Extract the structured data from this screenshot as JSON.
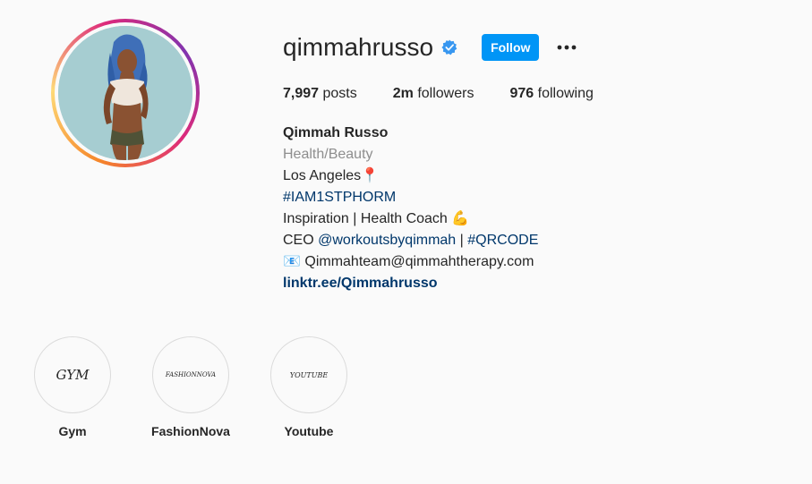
{
  "profile": {
    "username": "qimmahrusso",
    "verified": true,
    "follow_label": "Follow",
    "more_icon": "more-horizontal-icon",
    "accent_color": "#0095f6"
  },
  "stats": {
    "posts_count": "7,997",
    "posts_label": "posts",
    "followers_count": "2m",
    "followers_label": "followers",
    "following_count": "976",
    "following_label": "following"
  },
  "bio": {
    "full_name": "Qimmah Russo",
    "category": "Health/Beauty",
    "location": "Los Angeles",
    "location_emoji": "📍",
    "hashtag": "#IAM1STPHORM",
    "tagline": "Inspiration | Health Coach ",
    "tagline_emoji": "💪",
    "ceo_prefix": "CEO ",
    "ceo_mention": "@workoutsbyqimmah",
    "ceo_separator": " | ",
    "ceo_hashtag": "#QRCODE",
    "email_emoji": "📧",
    "email": "Qimmahteam@qimmahtherapy.com",
    "link": "linktr.ee/Qimmahrusso"
  },
  "highlights": [
    {
      "cover_text": "GYM",
      "label": "Gym"
    },
    {
      "cover_text": "FASHIONNOVA",
      "label": "FashionNova"
    },
    {
      "cover_text": "YOUTUBE",
      "label": "Youtube"
    }
  ]
}
